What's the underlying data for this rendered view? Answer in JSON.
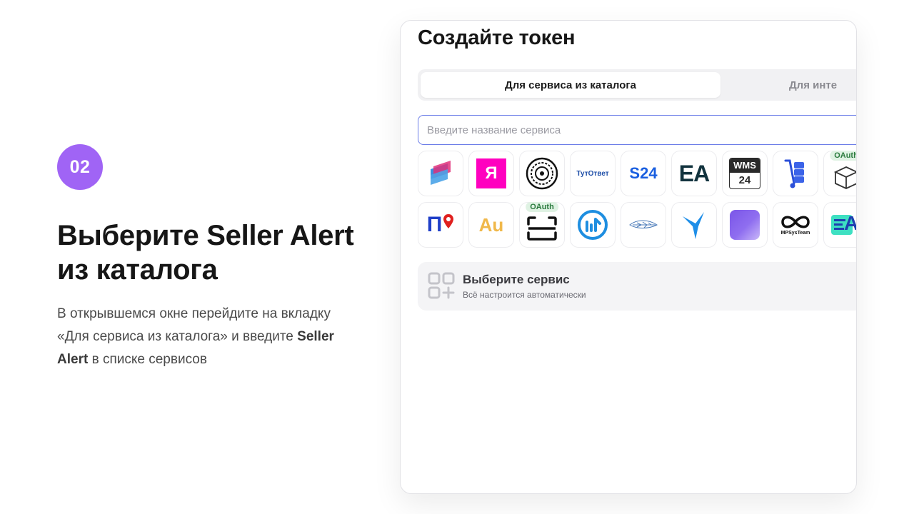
{
  "step": {
    "number": "02",
    "title_line1": "Выберите Seller Alert",
    "title_line2": "из каталога",
    "desc_part1": "В открывшемся окне перейдите на вкладку «Для сервиса из каталога» и введите ",
    "desc_bold": "Seller Alert",
    "desc_part2": " в списке сервисов"
  },
  "modal": {
    "title": "Создайте токен",
    "tabs": [
      {
        "label": "Для сервиса из каталога",
        "active": true
      },
      {
        "label": "Для инте",
        "active": false
      }
    ],
    "search": {
      "value": "",
      "placeholder": "Введите название сервиса"
    },
    "services_row1": [
      {
        "icon": "parallelogram-logo-icon"
      },
      {
        "icon": "yandex-logo-icon",
        "text": "Я"
      },
      {
        "icon": "mandala-logo-icon"
      },
      {
        "icon": "tutotvet-logo-icon",
        "text": "ТутОтвет"
      },
      {
        "icon": "s24-logo-icon",
        "text": "S24"
      },
      {
        "icon": "ea-logo-icon",
        "text": "EA"
      },
      {
        "icon": "wms24-logo-icon",
        "text": "WMS",
        "text2": "24"
      },
      {
        "icon": "hand-truck-logo-icon"
      },
      {
        "icon": "box-logo-icon",
        "badge": "OAuth"
      }
    ],
    "services_row2": [
      {
        "icon": "p-pin-logo-icon",
        "text": "П"
      },
      {
        "icon": "au-logo-icon",
        "text": "Au"
      },
      {
        "icon": "scan-frame-logo-icon",
        "badge": "OAuth"
      },
      {
        "icon": "chart-circle-logo-icon"
      },
      {
        "icon": "feather-logo-icon"
      },
      {
        "icon": "bird-logo-icon"
      },
      {
        "icon": "purple-square-logo-icon"
      },
      {
        "icon": "mpsysteam-logo-icon",
        "text": "MPSysTeam"
      },
      {
        "icon": "list-a-logo-icon",
        "text": "A"
      }
    ],
    "empty_state": {
      "title": "Выберите сервис",
      "subtitle": "Всё настроится автоматически"
    }
  }
}
